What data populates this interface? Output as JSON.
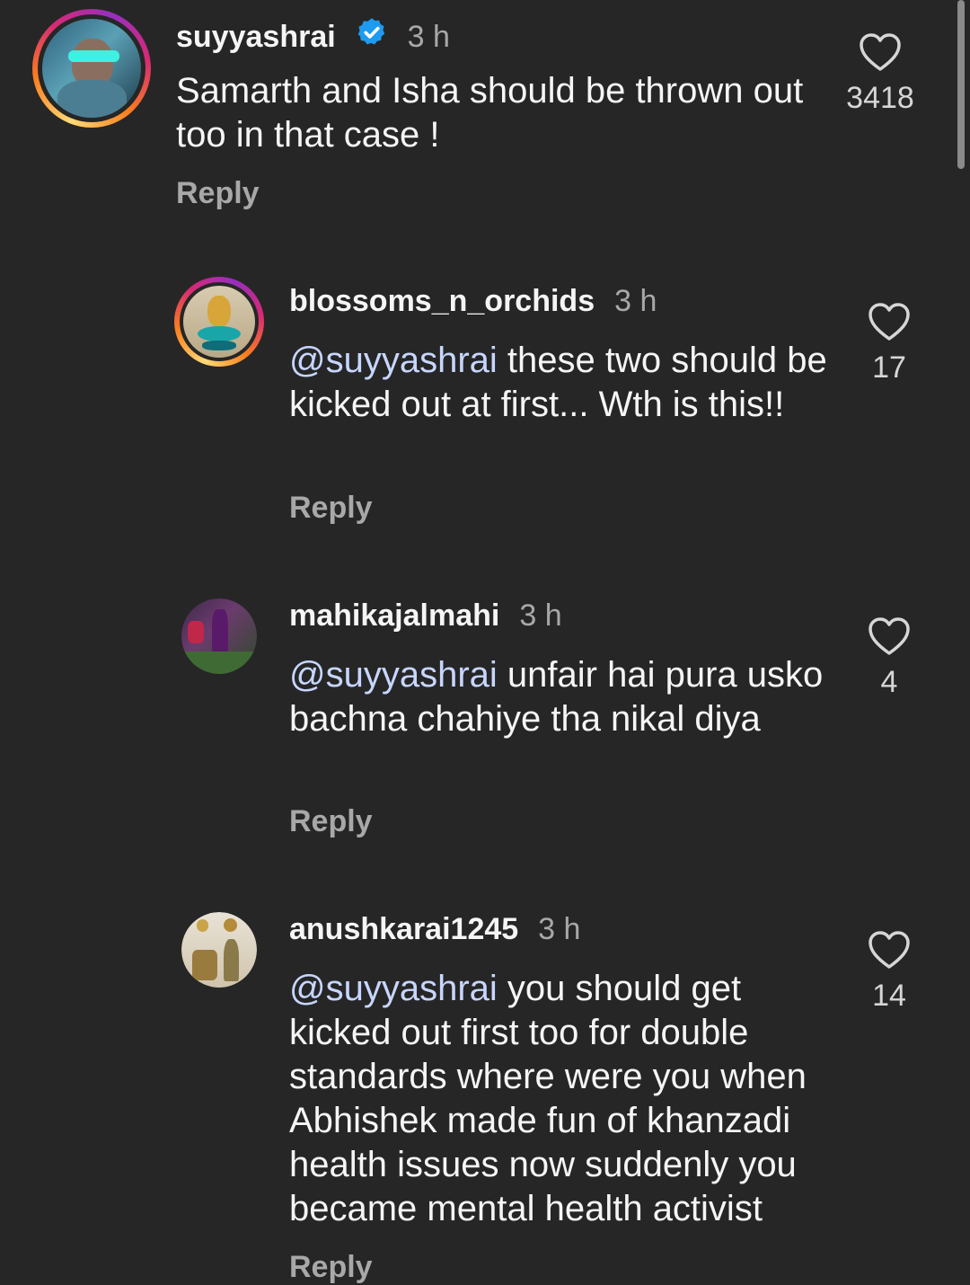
{
  "comments": [
    {
      "username": "suyyashrai",
      "verified": true,
      "time": "3 h",
      "mention": "",
      "text": "Samarth and Isha should be thrown out too in that case !",
      "reply": "Reply",
      "likes": "3418",
      "avatar_icon": "avatar-photo-man-sunglasses"
    },
    {
      "username": "blossoms_n_orchids",
      "verified": false,
      "time": "3 h",
      "mention": "@suyyashrai",
      "text": " these two should be kicked out at first... Wth is this!!",
      "reply": "Reply",
      "likes": "17",
      "avatar_icon": "avatar-photo-ganesha-idol"
    },
    {
      "username": "mahikajalmahi",
      "verified": false,
      "time": "3 h",
      "mention": "@suyyashrai",
      "text": " unfair hai pura usko bachna chahiye tha nikal diya",
      "reply": "Reply",
      "likes": "4",
      "avatar_icon": "avatar-photo-woman-garden"
    },
    {
      "username": "anushkarai1245",
      "verified": false,
      "time": "3 h",
      "mention": "@suyyashrai",
      "text": " you should get kicked out first too for double standards where were you when Abhishek made fun of khanzadi health issues now suddenly you became mental health activist",
      "reply": "Reply",
      "likes": "14",
      "avatar_icon": "avatar-photo-woman-room"
    }
  ],
  "colors": {
    "background": "#262626",
    "primary_text": "#f5f5f5",
    "secondary_text": "#a8a8a8",
    "mention": "#c7d6ff",
    "verified_badge": "#1d9bf0"
  }
}
